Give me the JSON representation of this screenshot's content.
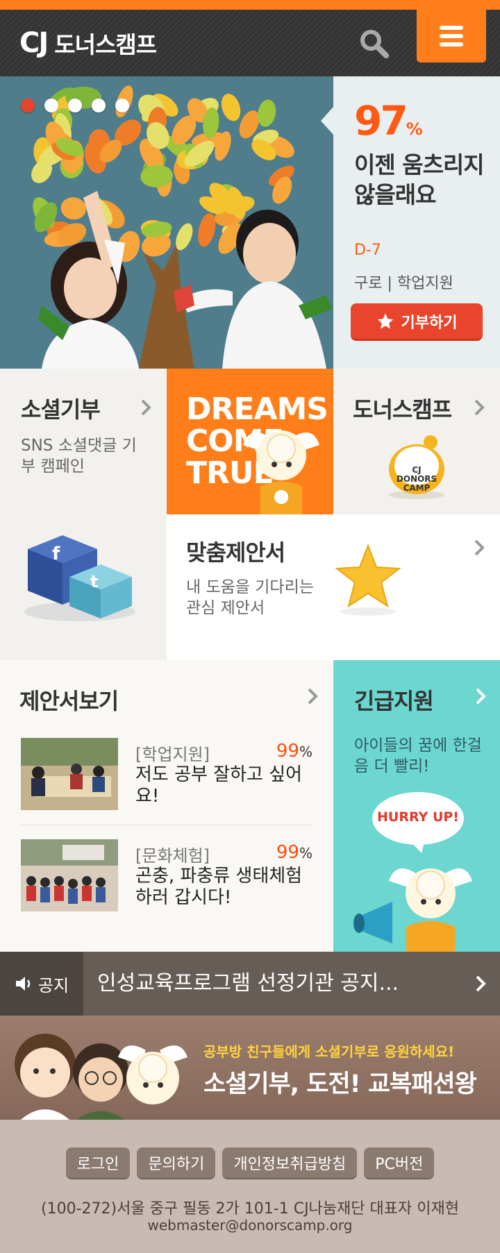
{
  "header": {
    "logo_cj": "CJ",
    "logo_text": "도너스캠프",
    "search_icon": "search-icon",
    "menu_icon": "hamburger-menu-icon"
  },
  "hero": {
    "slides": 5,
    "active_slide": 1,
    "percent": "97",
    "percent_unit": "%",
    "title": "이젠 움츠리지 않을래요",
    "dday": "D-7",
    "category": "구로 | 학업지원",
    "donate_label": "기부하기"
  },
  "tiles": {
    "social": {
      "title": "소셜기부",
      "desc": "SNS 소셜댓글 기부 캠페인"
    },
    "dreams": {
      "text": "DREAMS COME TRUE"
    },
    "donors": {
      "title": "도너스캠프",
      "badge": "CJ DONORS CAMP"
    },
    "custom": {
      "title": "맞춤제안서",
      "desc": "내 도움을 기다리는 관심 제안서"
    }
  },
  "proposals": {
    "title": "제안서보기",
    "items": [
      {
        "category": "[학업지원]",
        "percent": "99",
        "unit": "%",
        "title": "저도 공부 잘하고 싶어요!"
      },
      {
        "category": "[문화체험]",
        "percent": "99",
        "unit": "%",
        "title": "곤충, 파충류 생태체험하러 갑시다!"
      }
    ]
  },
  "urgent": {
    "title": "긴급지원",
    "desc": "아이들의 꿈에 한걸음 더 빨리!",
    "bubble": "HURRY UP!"
  },
  "notice": {
    "label": "공지",
    "text": "인성교육프로그램 선정기관 공지..."
  },
  "banner": {
    "sub": "공부방 친구들에게 소셜기부로 응원하세요!",
    "main": "소셜기부, 도전! 교복패션왕"
  },
  "footer": {
    "links": [
      "로그인",
      "문의하기",
      "개인정보취급방침",
      "PC버전"
    ],
    "address": "(100-272)서울 중구 필동 2가 101-1 CJ나눔재단 대표자 이재현",
    "email": "webmaster@donorscamp.org"
  },
  "colors": {
    "accent": "#ff7e1a",
    "red": "#e8452c",
    "teal": "#6cd6d0",
    "header": "#333333"
  }
}
